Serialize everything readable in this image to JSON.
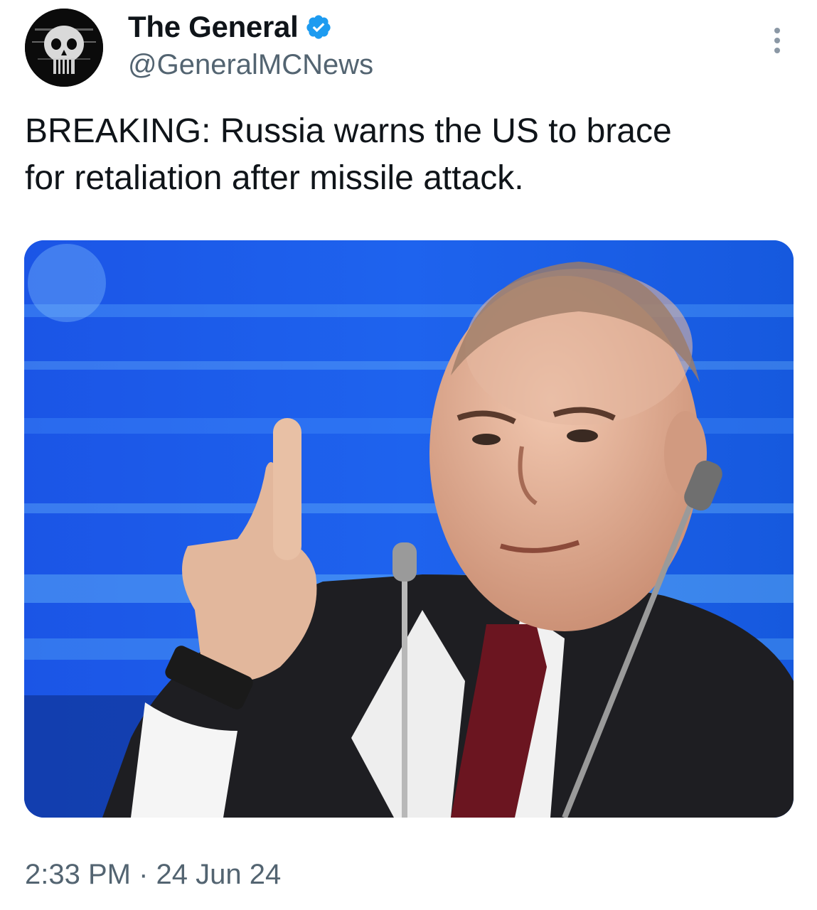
{
  "author": {
    "display_name": "The General",
    "handle": "@GeneralMCNews",
    "verified": true,
    "verified_color": "#1d9bf0"
  },
  "tweet": {
    "line1": "BREAKING: Russia warns the US to brace",
    "line2": "for retaliation after missile attack."
  },
  "media": {
    "type": "photo",
    "alt": "",
    "background_color": "#1f5de0"
  },
  "meta": {
    "time": "2:33 PM",
    "separator": "·",
    "date": "24 Jun 24"
  },
  "icons": {
    "avatar": "skull-avatar",
    "verified": "verified-badge-icon",
    "more": "more-options-icon"
  }
}
